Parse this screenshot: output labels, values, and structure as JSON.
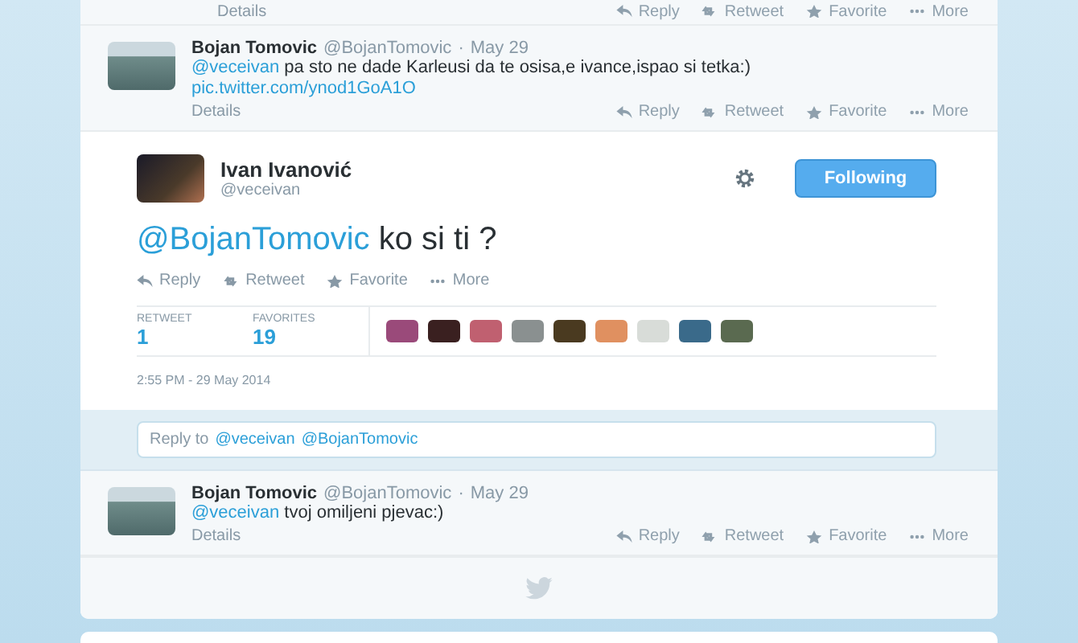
{
  "top_fragment": {
    "details": "Details",
    "actions": [
      {
        "kind": "reply",
        "label": "Reply"
      },
      {
        "kind": "retweet",
        "label": "Retweet"
      },
      {
        "kind": "favorite",
        "label": "Favorite"
      },
      {
        "kind": "more",
        "label": "More"
      }
    ]
  },
  "replies_before": [
    {
      "name": "Bojan Tomovic",
      "handle": "@BojanTomovic",
      "separator": "·",
      "time": "May 29",
      "mention": "@veceivan",
      "text": "pa sto ne dade Karleusi da te osisa,e ivance,ispao si tetka:)",
      "link": "pic.twitter.com/ynod1GoA1O",
      "details": "Details",
      "actions": [
        {
          "kind": "reply",
          "label": "Reply"
        },
        {
          "kind": "retweet",
          "label": "Retweet"
        },
        {
          "kind": "favorite",
          "label": "Favorite"
        },
        {
          "kind": "more",
          "label": "More"
        }
      ]
    }
  ],
  "tweet": {
    "name": "Ivan Ivanović",
    "handle": "@veceivan",
    "follow_button": "Following",
    "mention": "@BojanTomovic",
    "text": "ko si ti ?",
    "actions": [
      {
        "kind": "reply",
        "label": "Reply"
      },
      {
        "kind": "retweet",
        "label": "Retweet"
      },
      {
        "kind": "favorite",
        "label": "Favorite"
      },
      {
        "kind": "more",
        "label": "More"
      }
    ],
    "stats": [
      {
        "label": "RETWEET",
        "value": "1"
      },
      {
        "label": "FAVORITES",
        "value": "19"
      }
    ],
    "favoriters": [
      {
        "color": "#9a4a7a"
      },
      {
        "color": "#3a2020"
      },
      {
        "color": "#c06070"
      },
      {
        "color": "#8a9090"
      },
      {
        "color": "#4a3a20"
      },
      {
        "color": "#e09060"
      },
      {
        "color": "#d8dcd8"
      },
      {
        "color": "#3a6a8a"
      },
      {
        "color": "#5a6a50"
      }
    ],
    "timestamp": "2:55 PM - 29 May 2014"
  },
  "reply_box": {
    "placeholder": "Reply to",
    "mentions": [
      "@veceivan",
      "@BojanTomovic"
    ]
  },
  "replies_after": [
    {
      "name": "Bojan Tomovic",
      "handle": "@BojanTomovic",
      "separator": "·",
      "time": "May 29",
      "mention": "@veceivan",
      "text": "tvoj omiljeni pjevac:)",
      "details": "Details",
      "actions": [
        {
          "kind": "reply",
          "label": "Reply"
        },
        {
          "kind": "retweet",
          "label": "Retweet"
        },
        {
          "kind": "favorite",
          "label": "Favorite"
        },
        {
          "kind": "more",
          "label": "More"
        }
      ]
    }
  ]
}
